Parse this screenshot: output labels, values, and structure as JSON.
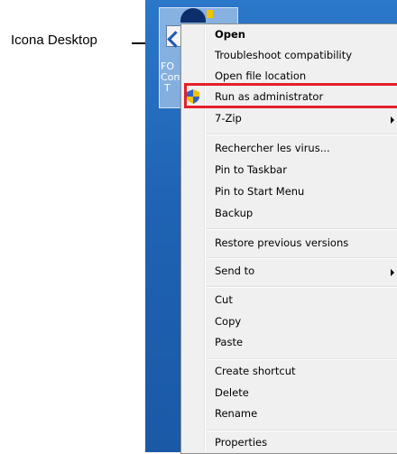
{
  "callout": {
    "label": "Icona Desktop"
  },
  "desktop_icon": {
    "text_lines": [
      "FO",
      "Conf",
      "T"
    ]
  },
  "menu": {
    "open": "Open",
    "troubleshoot": "Troubleshoot compatibility",
    "open_location": "Open file location",
    "run_as_admin": "Run as administrator",
    "seven_zip": "7-Zip",
    "scan": "Rechercher les virus...",
    "pin_taskbar": "Pin to Taskbar",
    "pin_start": "Pin to Start Menu",
    "backup": "Backup",
    "restore": "Restore previous versions",
    "send_to": "Send to",
    "cut": "Cut",
    "copy": "Copy",
    "paste": "Paste",
    "create_shortcut": "Create shortcut",
    "delete": "Delete",
    "rename": "Rename",
    "properties": "Properties"
  },
  "colors": {
    "highlight_border": "#e3202a",
    "desktop_blue": "#1f63b4",
    "menu_bg": "#f0f0f0"
  }
}
